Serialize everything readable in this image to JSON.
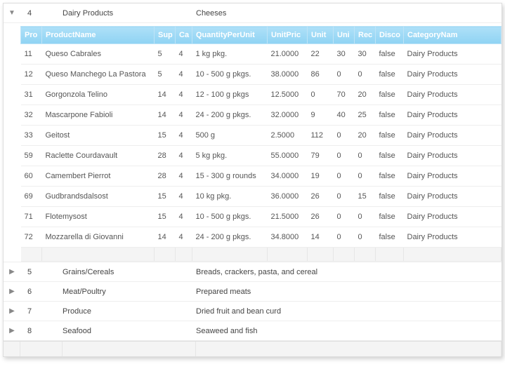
{
  "categories": [
    {
      "id": "4",
      "name": "Dairy Products",
      "desc": "Cheeses",
      "expanded": true
    },
    {
      "id": "5",
      "name": "Grains/Cereals",
      "desc": "Breads, crackers, pasta, and cereal",
      "expanded": false
    },
    {
      "id": "6",
      "name": "Meat/Poultry",
      "desc": "Prepared meats",
      "expanded": false
    },
    {
      "id": "7",
      "name": "Produce",
      "desc": "Dried fruit and bean curd",
      "expanded": false
    },
    {
      "id": "8",
      "name": "Seafood",
      "desc": "Seaweed and fish",
      "expanded": false
    }
  ],
  "detailHeaders": {
    "pid": "Pro",
    "name": "ProductName",
    "sup": "Sup",
    "cat": "Ca",
    "qpu": "QuantityPerUnit",
    "price": "UnitPric",
    "uis": "Unit",
    "uoo": "Uni",
    "rec": "Rec",
    "disc": "Disco",
    "catn": "CategoryNam"
  },
  "detailRows": [
    {
      "pid": "11",
      "name": "Queso Cabrales",
      "sup": "5",
      "cat": "4",
      "qpu": "1 kg pkg.",
      "price": "21.0000",
      "uis": "22",
      "uoo": "30",
      "rec": "30",
      "disc": "false",
      "catn": "Dairy Products"
    },
    {
      "pid": "12",
      "name": "Queso Manchego La Pastora",
      "sup": "5",
      "cat": "4",
      "qpu": "10 - 500 g pkgs.",
      "price": "38.0000",
      "uis": "86",
      "uoo": "0",
      "rec": "0",
      "disc": "false",
      "catn": "Dairy Products"
    },
    {
      "pid": "31",
      "name": "Gorgonzola Telino",
      "sup": "14",
      "cat": "4",
      "qpu": "12 - 100 g pkgs",
      "price": "12.5000",
      "uis": "0",
      "uoo": "70",
      "rec": "20",
      "disc": "false",
      "catn": "Dairy Products"
    },
    {
      "pid": "32",
      "name": "Mascarpone Fabioli",
      "sup": "14",
      "cat": "4",
      "qpu": "24 - 200 g pkgs.",
      "price": "32.0000",
      "uis": "9",
      "uoo": "40",
      "rec": "25",
      "disc": "false",
      "catn": "Dairy Products"
    },
    {
      "pid": "33",
      "name": "Geitost",
      "sup": "15",
      "cat": "4",
      "qpu": "500 g",
      "price": "2.5000",
      "uis": "112",
      "uoo": "0",
      "rec": "20",
      "disc": "false",
      "catn": "Dairy Products"
    },
    {
      "pid": "59",
      "name": "Raclette Courdavault",
      "sup": "28",
      "cat": "4",
      "qpu": "5 kg pkg.",
      "price": "55.0000",
      "uis": "79",
      "uoo": "0",
      "rec": "0",
      "disc": "false",
      "catn": "Dairy Products"
    },
    {
      "pid": "60",
      "name": "Camembert Pierrot",
      "sup": "28",
      "cat": "4",
      "qpu": "15 - 300 g rounds",
      "price": "34.0000",
      "uis": "19",
      "uoo": "0",
      "rec": "0",
      "disc": "false",
      "catn": "Dairy Products"
    },
    {
      "pid": "69",
      "name": "Gudbrandsdalsost",
      "sup": "15",
      "cat": "4",
      "qpu": "10 kg pkg.",
      "price": "36.0000",
      "uis": "26",
      "uoo": "0",
      "rec": "15",
      "disc": "false",
      "catn": "Dairy Products"
    },
    {
      "pid": "71",
      "name": "Flotemysost",
      "sup": "15",
      "cat": "4",
      "qpu": "10 - 500 g pkgs.",
      "price": "21.5000",
      "uis": "26",
      "uoo": "0",
      "rec": "0",
      "disc": "false",
      "catn": "Dairy Products"
    },
    {
      "pid": "72",
      "name": "Mozzarella di Giovanni",
      "sup": "14",
      "cat": "4",
      "qpu": "24 - 200 g pkgs.",
      "price": "34.8000",
      "uis": "14",
      "uoo": "0",
      "rec": "0",
      "disc": "false",
      "catn": "Dairy Products"
    }
  ]
}
